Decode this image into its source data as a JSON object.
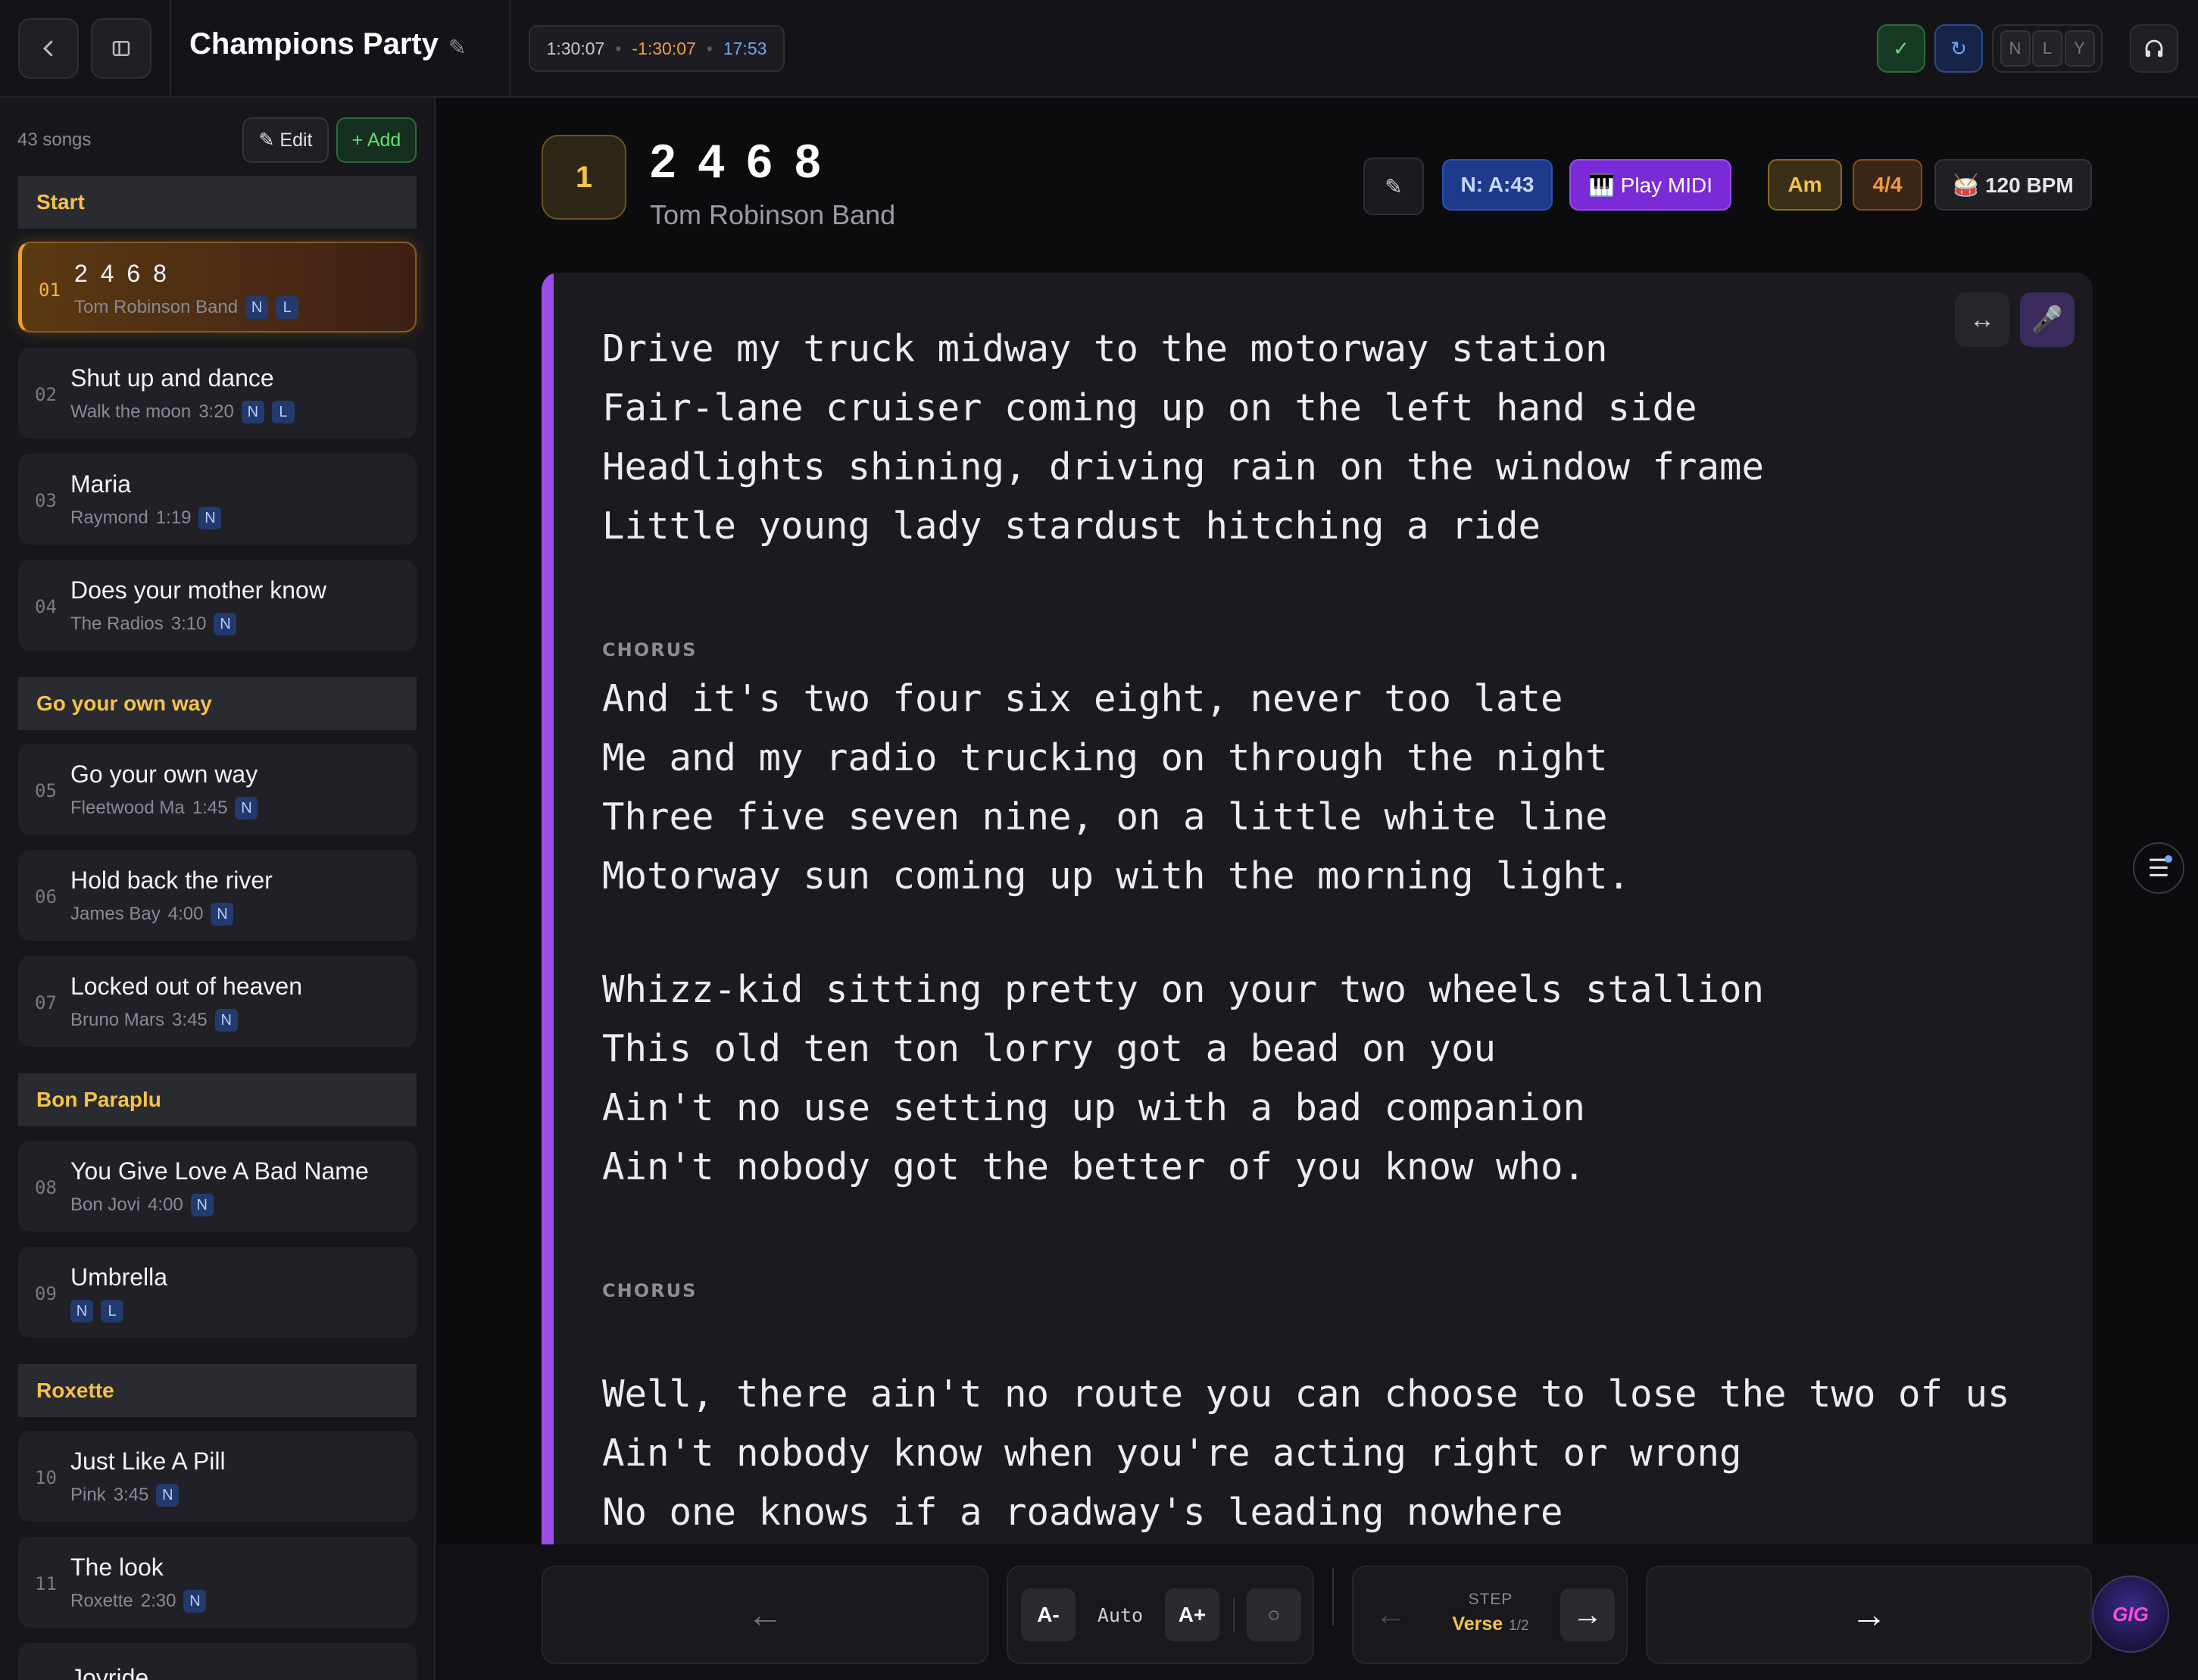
{
  "header": {
    "title": "Champions Party",
    "time_elapsed": "1:30:07",
    "time_remaining": "-1:30:07",
    "time_total": "17:53",
    "mode_toggles": [
      "N",
      "L",
      "Y"
    ],
    "icons": {
      "back": "chevron-left-icon",
      "sidebar": "sidebar-toggle-icon",
      "edit": "pencil-icon",
      "confirm": "check-icon",
      "sync": "refresh-icon",
      "audio": "headphones-icon"
    },
    "colors": {
      "confirm": "#5fe07a",
      "sync": "#6aa8ff",
      "accent": "#f5c24a"
    }
  },
  "sidebar": {
    "count": "43 songs",
    "edit_label": "✎ Edit",
    "add_label": "+ Add",
    "groups": [
      {
        "name": "Start"
      },
      {
        "name": "Go your own way"
      },
      {
        "name": "Bon Paraplu"
      },
      {
        "name": "Roxette"
      }
    ],
    "songs": [
      {
        "num": "01",
        "title": "2 4 6 8",
        "artist": "Tom Robinson Band",
        "duration": "",
        "tags": [
          "N",
          "L"
        ]
      },
      {
        "num": "02",
        "title": "Shut up and dance",
        "artist": "Walk the moon",
        "duration": "3:20",
        "tags": [
          "N",
          "L"
        ]
      },
      {
        "num": "03",
        "title": "Maria",
        "artist": "Raymond",
        "duration": "1:19",
        "tags": [
          "N"
        ]
      },
      {
        "num": "04",
        "title": "Does your mother know",
        "artist": "The Radios",
        "duration": "3:10",
        "tags": [
          "N"
        ]
      },
      {
        "num": "05",
        "title": "Go your own way",
        "artist": "Fleetwood Ma",
        "duration": "1:45",
        "tags": [
          "N"
        ]
      },
      {
        "num": "06",
        "title": "Hold back the river",
        "artist": "James Bay",
        "duration": "4:00",
        "tags": [
          "N"
        ]
      },
      {
        "num": "07",
        "title": "Locked out of heaven",
        "artist": "Bruno Mars",
        "duration": "3:45",
        "tags": [
          "N"
        ]
      },
      {
        "num": "08",
        "title": "You Give Love A Bad Name",
        "artist": "Bon Jovi",
        "duration": "4:00",
        "tags": [
          "N"
        ]
      },
      {
        "num": "09",
        "title": "Umbrella",
        "artist": "",
        "duration": "",
        "tags": [
          "N",
          "L"
        ]
      },
      {
        "num": "10",
        "title": "Just Like A Pill",
        "artist": "Pink",
        "duration": "3:45",
        "tags": [
          "N"
        ]
      },
      {
        "num": "11",
        "title": "The look",
        "artist": "Roxette",
        "duration": "2:30",
        "tags": [
          "N"
        ]
      },
      {
        "num": "",
        "title": "Joyride",
        "artist": "",
        "duration": "",
        "tags": []
      }
    ]
  },
  "song": {
    "position": "1",
    "title": "2 4 6 8",
    "artist": "Tom Robinson Band",
    "notes_chip": "N: A:43",
    "play_midi": "🎹 Play MIDI",
    "key": "Am",
    "time_signature": "4/4",
    "tempo": "🥁 120 BPM"
  },
  "lyrics": {
    "verse1": [
      "Drive my truck midway to the motorway station",
      "Fair-lane cruiser coming up on the left hand side",
      "Headlights shining, driving rain on the window frame",
      "Little young lady stardust hitching a ride"
    ],
    "chorus_label": "CHORUS",
    "chorus": [
      "And it's two four six eight, never too late",
      "Me and my radio trucking on through the night",
      "Three five seven nine, on a little white line",
      "Motorway sun coming up with the morning light."
    ],
    "verse2": [
      "Whizz-kid sitting pretty on your two wheels stallion",
      "This old ten ton lorry got a bead on you",
      "Ain't no use setting up with a bad companion",
      "Ain't nobody got the better of you know who."
    ],
    "chorus2_label": "CHORUS",
    "verse3": [
      "Well, there ain't no route you can choose to lose the two of us",
      "Ain't nobody know when you're acting right or wrong",
      "No one knows if a roadway's leading nowhere"
    ]
  },
  "controls": {
    "prev_song": "←",
    "font_smaller": "A-",
    "font_auto": "Auto",
    "font_larger": "A+",
    "toggle": "○",
    "step_prev": "←",
    "step_label": "STEP",
    "step_section": "Verse",
    "step_progress": "1/2",
    "step_next": "→",
    "next_song": "→",
    "logo_text": "GIG"
  }
}
